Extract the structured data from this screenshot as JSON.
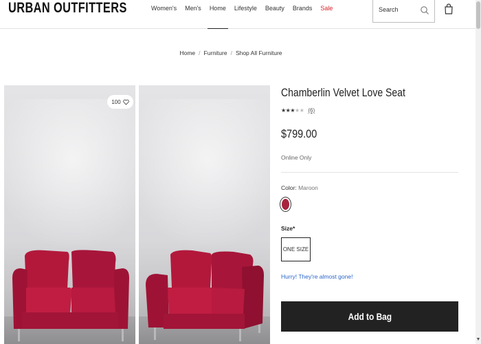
{
  "brand": {
    "logo_text": "URBAN OUTFITTERS"
  },
  "nav": {
    "items": [
      {
        "label": "Women's"
      },
      {
        "label": "Men's"
      },
      {
        "label": "Home"
      },
      {
        "label": "Lifestyle"
      },
      {
        "label": "Beauty"
      },
      {
        "label": "Brands"
      },
      {
        "label": "Sale"
      }
    ],
    "active": "Home"
  },
  "search": {
    "placeholder": "Search"
  },
  "breadcrumb": [
    {
      "label": "Home"
    },
    {
      "label": "Furniture"
    },
    {
      "label": "Shop All Furniture"
    }
  ],
  "gallery": {
    "wishlist_count": "100"
  },
  "product": {
    "title": "Chamberlin Velvet Love Seat",
    "rating": 3,
    "rating_max": 5,
    "review_count": "(6)",
    "price": "$799.00",
    "availability": "Online Only",
    "color_label": "Color:",
    "color_value": "Maroon",
    "swatch_color": "#a8223d",
    "size_label": "Size*",
    "size_option": "ONE SIZE",
    "stock_message": "Hurry! They're almost gone!",
    "add_to_bag_label": "Add to Bag"
  },
  "colors": {
    "sale": "#d8222a",
    "link_blue": "#2a66c9",
    "sofa": "#b3183b",
    "button_bg": "#222222"
  }
}
